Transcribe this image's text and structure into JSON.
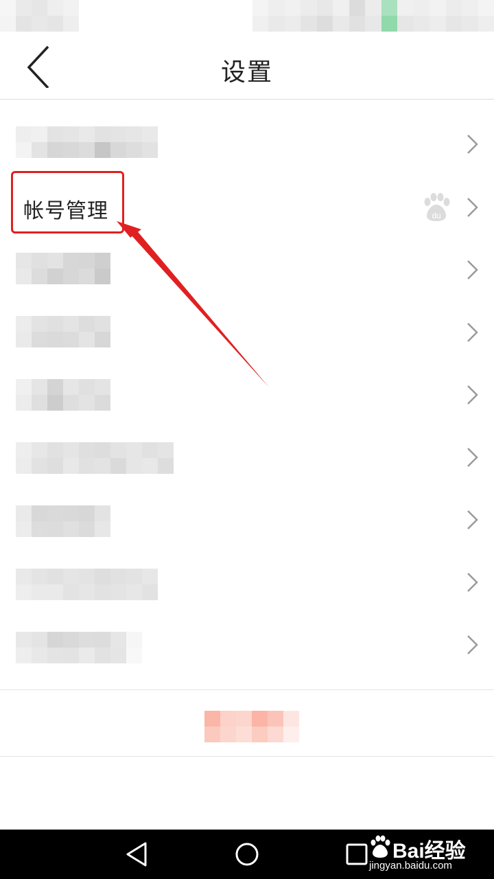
{
  "header": {
    "title": "设置"
  },
  "settings": {
    "account_label": "帐号管理"
  },
  "icons": {
    "back": "chevron-left-icon",
    "row": "chevron-right-icon",
    "account_badge": "baidu-paw-icon"
  },
  "annotation": {
    "color": "#e02020"
  },
  "watermark": {
    "brand": "Bai经验",
    "url": "jingyan.baidu.com"
  }
}
